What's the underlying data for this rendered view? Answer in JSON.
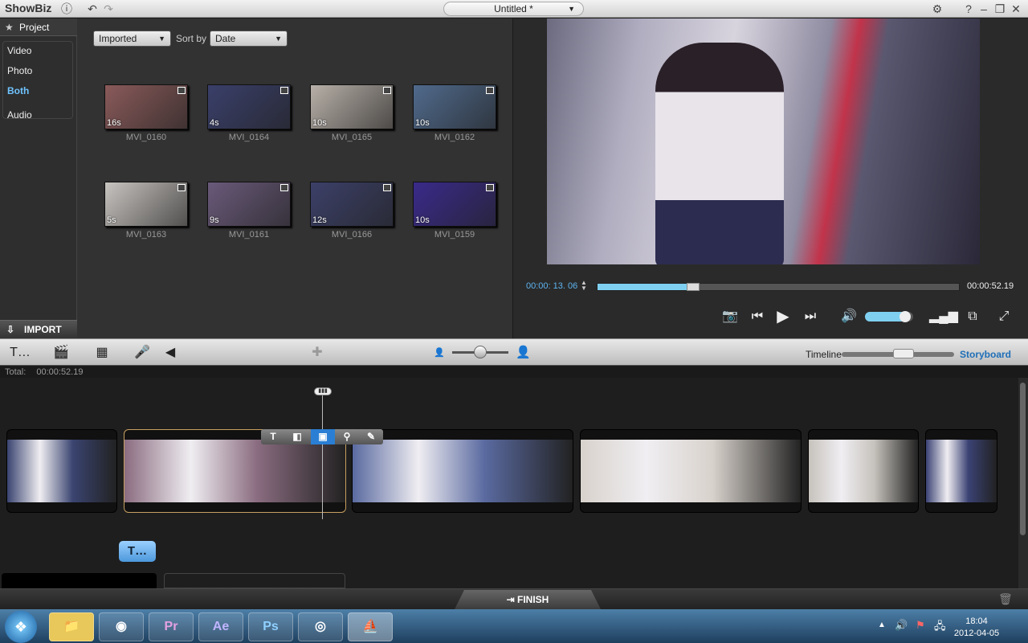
{
  "titlebar": {
    "app_name": "ShowBiz",
    "project_title": "Untitled *",
    "help": "?"
  },
  "library": {
    "header": "Project",
    "filters": [
      "Video",
      "Photo",
      "Both",
      "Audio"
    ],
    "active_filter": "Both",
    "import_label": "IMPORT",
    "source_dropdown": "Imported",
    "sort_label": "Sort by",
    "sort_dropdown": "Date",
    "items": [
      {
        "name": "MVI_0160",
        "duration": "16s",
        "color": "#8a5a5a"
      },
      {
        "name": "MVI_0164",
        "duration": "4s",
        "color": "#3a3f6a"
      },
      {
        "name": "MVI_0165",
        "duration": "10s",
        "color": "#b8b0a8"
      },
      {
        "name": "MVI_0162",
        "duration": "10s",
        "color": "#506a8c"
      },
      {
        "name": "MVI_0163",
        "duration": "5s",
        "color": "#c8c4c0"
      },
      {
        "name": "MVI_0161",
        "duration": "9s",
        "color": "#6a5a7a"
      },
      {
        "name": "MVI_0166",
        "duration": "12s",
        "color": "#3c4068"
      },
      {
        "name": "MVI_0159",
        "duration": "10s",
        "color": "#3a2a8a"
      }
    ]
  },
  "preview": {
    "current_time": "00:00: 13. 06",
    "total_time": "00:00:52.19",
    "progress": 0.25,
    "volume": 0.85
  },
  "toolbar": {
    "timeline_label": "Timeline",
    "storyboard_label": "Storyboard",
    "zoom": 0.5
  },
  "storyboard": {
    "total_label": "Total:",
    "total_value": "00:00:52.19",
    "finish_label": "FINISH",
    "clips": [
      {
        "color": "#3a4470"
      },
      {
        "color": "#8a6c80"
      },
      {
        "color": "#5a6aa0"
      },
      {
        "color": "#d8d2cc"
      },
      {
        "color": "#c6c2bc"
      },
      {
        "color": "#3a4274"
      }
    ]
  },
  "taskbar": {
    "premiere": "Pr",
    "after_effects": "Ae",
    "photoshop": "Ps",
    "time": "18:04",
    "date": "2012-04-05"
  }
}
